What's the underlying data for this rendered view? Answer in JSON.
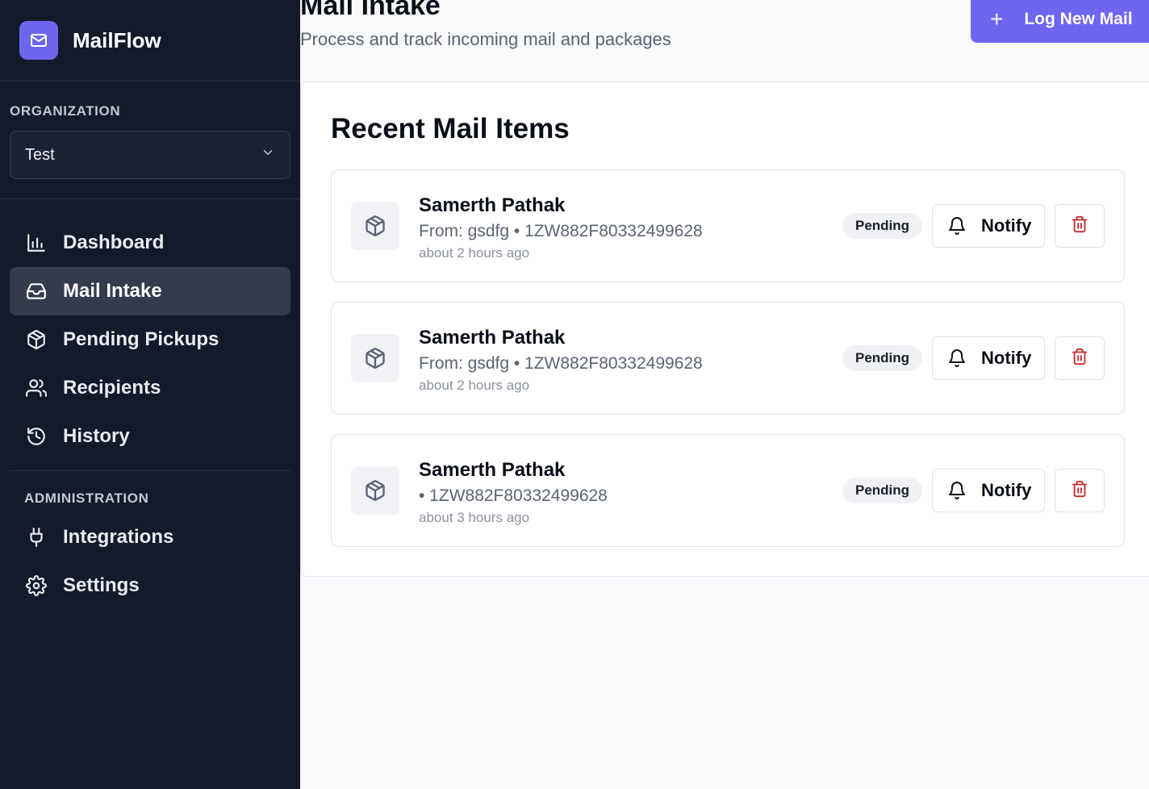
{
  "app": {
    "name": "MailFlow",
    "logo_icon": "mail-icon",
    "accent": "#6f66f0"
  },
  "sidebar": {
    "org_label": "ORGANIZATION",
    "org_selected": "Test",
    "nav": [
      {
        "label": "Dashboard",
        "icon": "bar-chart-icon",
        "active": false
      },
      {
        "label": "Mail Intake",
        "icon": "inbox-icon",
        "active": true
      },
      {
        "label": "Pending Pickups",
        "icon": "package-icon",
        "active": false
      },
      {
        "label": "Recipients",
        "icon": "users-icon",
        "active": false
      },
      {
        "label": "History",
        "icon": "history-icon",
        "active": false
      }
    ],
    "admin_label": "ADMINISTRATION",
    "admin_nav": [
      {
        "label": "Integrations",
        "icon": "plug-icon"
      },
      {
        "label": "Settings",
        "icon": "gear-icon"
      }
    ]
  },
  "header": {
    "title": "Mail Intake",
    "subtitle": "Process and track incoming mail and packages",
    "log_button": "Log New Mail"
  },
  "recent": {
    "title": "Recent Mail Items",
    "items": [
      {
        "name": "Samerth Pathak",
        "details": "From: gsdfg • 1ZW882F80332499628",
        "time": "about 2 hours ago",
        "status": "Pending",
        "notify_label": "Notify"
      },
      {
        "name": "Samerth Pathak",
        "details": "From: gsdfg • 1ZW882F80332499628",
        "time": "about 2 hours ago",
        "status": "Pending",
        "notify_label": "Notify"
      },
      {
        "name": "Samerth Pathak",
        "details": "• 1ZW882F80332499628",
        "time": "about 3 hours ago",
        "status": "Pending",
        "notify_label": "Notify"
      }
    ]
  },
  "colors": {
    "sidebar_bg": "#131a2a",
    "active_nav_bg": "#343b4b",
    "delete_red": "#c62828"
  }
}
